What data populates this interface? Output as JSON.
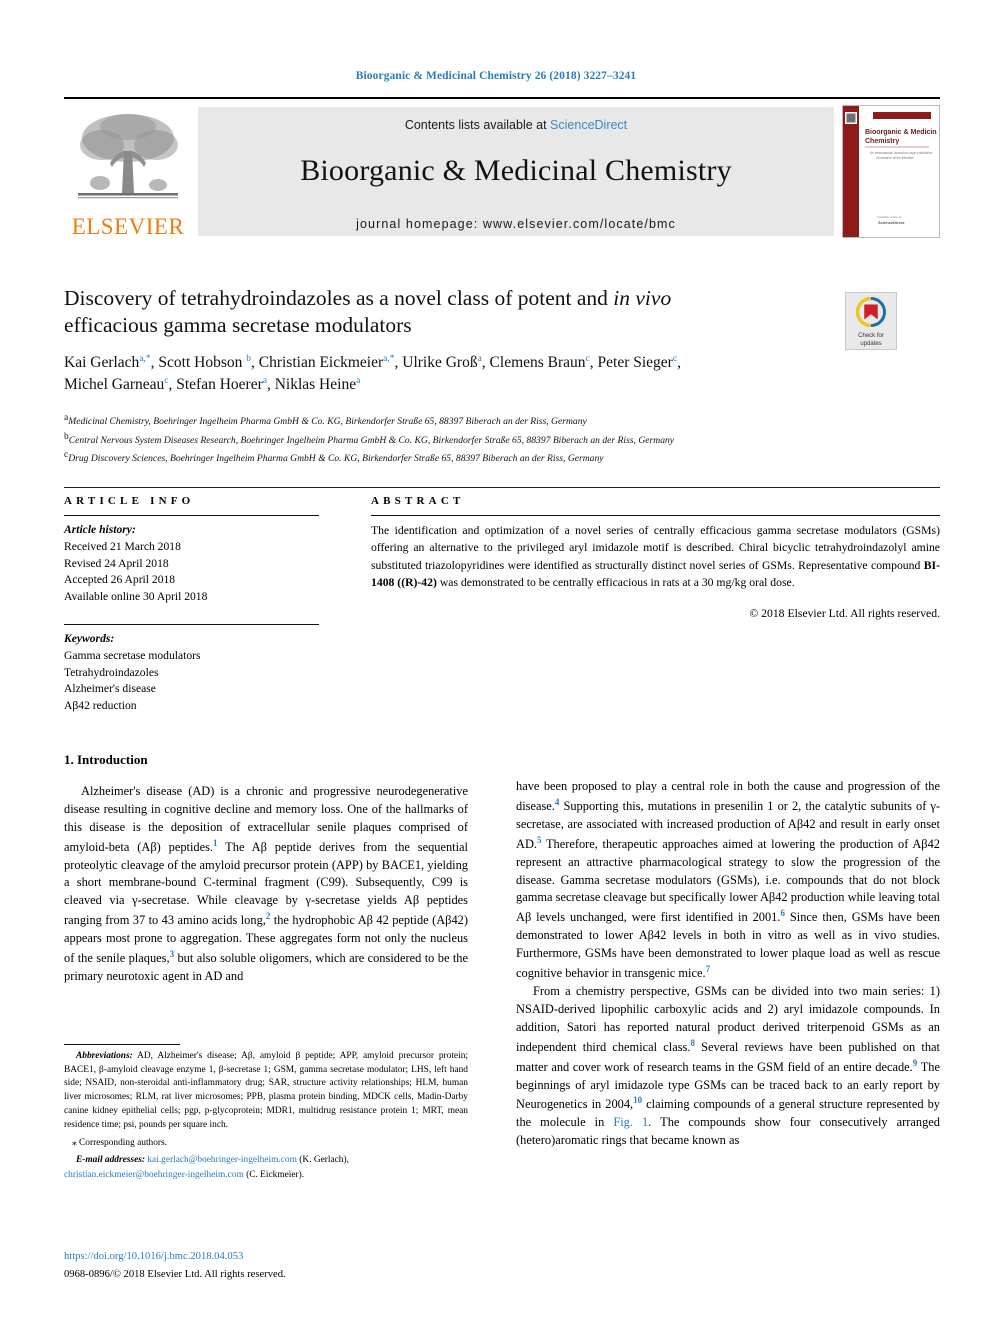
{
  "journal_ref": "Bioorganic & Medicinal Chemistry 26 (2018) 3227–3241",
  "masthead": {
    "contents_prefix": "Contents lists available at ",
    "sciencedirect": "ScienceDirect",
    "journal_name": "Bioorganic & Medicinal Chemistry",
    "homepage": "journal homepage: www.elsevier.com/locate/bmc",
    "publisher_wordmark": "ELSEVIER",
    "cover_title": "Bioorganic & Medicinal Chemistry",
    "cover_subtitle": "An International Journal for rapid publication of research at the interface of chemistry and biology",
    "cover_footer": "Available online at",
    "cover_footer2": "ScienceDirect"
  },
  "title": {
    "line1_a": "Discovery of tetrahydroindazoles as a novel class of potent and ",
    "line1_em": "in vivo",
    "line2": "efficacious gamma secretase modulators"
  },
  "crossmark": {
    "line1": "Check for",
    "line2": "updates",
    "colors": {
      "outer": "#1c6ea4",
      "arc": "#f5c518",
      "inner": "#cf2027"
    }
  },
  "authors": [
    {
      "name": "Kai Gerlach",
      "sup": "a,*",
      "sep": ", "
    },
    {
      "name": "Scott Hobson",
      "sup": "b",
      "sep": ", "
    },
    {
      "name": "Christian Eickmeier",
      "sup": "a,*",
      "sep": ", "
    },
    {
      "name": "Ulrike Groß",
      "sup": "a",
      "sep": ", "
    },
    {
      "name": "Clemens Braun",
      "sup": "c",
      "sep": ", "
    },
    {
      "name": "Peter Sieger",
      "sup": "c",
      "sep": ", "
    },
    {
      "name": "Michel Garneau",
      "sup": "c",
      "sep": ", "
    },
    {
      "name": "Stefan Hoerer",
      "sup": "a",
      "sep": ", "
    },
    {
      "name": "Niklas Heine",
      "sup": "a",
      "sep": ""
    }
  ],
  "affiliations": [
    {
      "mark": "a",
      "text": "Medicinal Chemistry, Boehringer Ingelheim Pharma GmbH & Co. KG, Birkendorfer Straße 65, 88397 Biberach an der Riss, Germany"
    },
    {
      "mark": "b",
      "text": "Central Nervous System Diseases Research, Boehringer Ingelheim Pharma GmbH & Co. KG, Birkendorfer Straße 65, 88397 Biberach an der Riss, Germany"
    },
    {
      "mark": "c",
      "text": "Drug Discovery Sciences, Boehringer Ingelheim Pharma GmbH & Co. KG, Birkendorfer Straße 65, 88397 Biberach an der Riss, Germany"
    }
  ],
  "article_info": {
    "heading": "ARTICLE INFO",
    "history_label": "Article history:",
    "history": [
      "Received 21 March 2018",
      "Revised 24 April 2018",
      "Accepted 26 April 2018",
      "Available online 30 April 2018"
    ],
    "keywords_label": "Keywords:",
    "keywords": [
      "Gamma secretase modulators",
      "Tetrahydroindazoles",
      "Alzheimer's disease",
      "Aβ42 reduction"
    ]
  },
  "abstract": {
    "heading": "ABSTRACT",
    "text": "The identification and optimization of a novel series of centrally efficacious gamma secretase modulators (GSMs) offering an alternative to the privileged aryl imidazole motif is described. Chiral bicyclic tetrahydroindazolyl amine substituted triazolopyridines were identified as structurally distinct novel series of GSMs. Representative compound BI-1408 ((R)-42) was demonstrated to be centrally efficacious in rats at a 30 mg/kg oral dose.",
    "bold_compound": "BI-1408",
    "bold_stereo": "((R)-42)",
    "copyright": "© 2018 Elsevier Ltd. All rights reserved."
  },
  "intro": {
    "section_title": "1. Introduction",
    "left_p1": "Alzheimer's disease (AD) is a chronic and progressive neurodegenerative disease resulting in cognitive decline and memory loss. One of the hallmarks of this disease is the deposition of extracellular senile plaques comprised of amyloid-beta (Aβ) peptides.",
    "left_p1_ref1": "1",
    "left_p1_b": " The Aβ peptide derives from the sequential proteolytic cleavage of the amyloid precursor protein (APP) by BACE1, yielding a short membrane-bound C-terminal fragment (C99). Subsequently, C99 is cleaved via γ-secretase. While cleavage by γ-secretase yields Aβ peptides ranging from 37 to 43 amino acids long,",
    "left_p1_ref2": "2",
    "left_p1_c": " the hydrophobic Aβ 42 peptide (Aβ42) appears most prone to aggregation. These aggregates form not only the nucleus of the senile plaques,",
    "left_p1_ref3": "3",
    "left_p1_d": " but also soluble oligomers, which are considered to be the primary neurotoxic agent in AD and",
    "right_p1_a": "have been proposed to play a central role in both the cause and progression of the disease.",
    "right_p1_ref4": "4",
    "right_p1_b": " Supporting this, mutations in presenilin 1 or 2, the catalytic subunits of γ-secretase, are associated with increased production of Aβ42 and result in early onset AD.",
    "right_p1_ref5": "5",
    "right_p1_c": " Therefore, therapeutic approaches aimed at lowering the production of Aβ42 represent an attractive pharmacological strategy to slow the progression of the disease. Gamma secretase modulators (GSMs), i.e. compounds that do not block gamma secretase cleavage but specifically lower Aβ42 production while leaving total Aβ levels unchanged, were first identified in 2001.",
    "right_p1_ref6": "6",
    "right_p1_d": " Since then, GSMs have been demonstrated to lower Aβ42 levels in both in vitro as well as in vivo studies. Furthermore, GSMs have been demonstrated to lower plaque load as well as rescue cognitive behavior in transgenic mice.",
    "right_p1_ref7": "7",
    "right_p2_a": "From a chemistry perspective, GSMs can be divided into two main series: 1) NSAID-derived lipophilic carboxylic acids and 2) aryl imidazole compounds. In addition, Satori has reported natural product derived triterpenoid GSMs as an independent third chemical class.",
    "right_p2_ref8": "8",
    "right_p2_b": " Several reviews have been published on that matter and cover work of research teams in the GSM field of an entire decade.",
    "right_p2_ref9": "9",
    "right_p2_c": " The beginnings of aryl imidazole type GSMs can be traced back to an early report by Neurogenetics in 2004,",
    "right_p2_ref10": "10",
    "right_p2_d": " claiming compounds of a general structure represented by the molecule in ",
    "right_p2_fig": "Fig. 1",
    "right_p2_e": ". The compounds show four consecutively arranged (hetero)aromatic rings that became known as"
  },
  "footnotes": {
    "abbrev_label": "Abbreviations:",
    "abbrev_text": " AD, Alzheimer's disease; Aβ, amyloid β peptide; APP, amyloid precursor protein; BACE1, β-amyloid cleavage enzyme 1, β-secretase 1; GSM, gamma secretase modulator; LHS, left hand side; NSAID, non-steroidal anti-inflammatory drug; SAR, structure activity relationships; HLM, human liver microsomes; RLM, rat liver microsomes; PPB, plasma protein binding, MDCK cells, Madin-Darby canine kidney epithelial cells; pgp, p-glycoprotein; MDR1, multidrug resistance protein 1; MRT, mean residence time; psi, pounds per square inch.",
    "corresponding": "⁎ Corresponding authors.",
    "email_label": "E-mail addresses:",
    "email1": "kai.gerlach@boehringer-ingelheim.com",
    "email1_who": " (K. Gerlach), ",
    "email2": "christian.eickmeier@boehringer-ingelheim.com",
    "email2_who": " (C. Eickmeier)."
  },
  "footer": {
    "doi": "https://doi.org/10.1016/j.bmc.2018.04.053",
    "issn": "0968-0896/© 2018 Elsevier Ltd. All rights reserved."
  },
  "colors": {
    "link": "#2b7bb9",
    "elsevier_orange": "#ee7d11",
    "masthead_bg": "#e8e8e8",
    "cover_red": "#8d1b1b"
  }
}
